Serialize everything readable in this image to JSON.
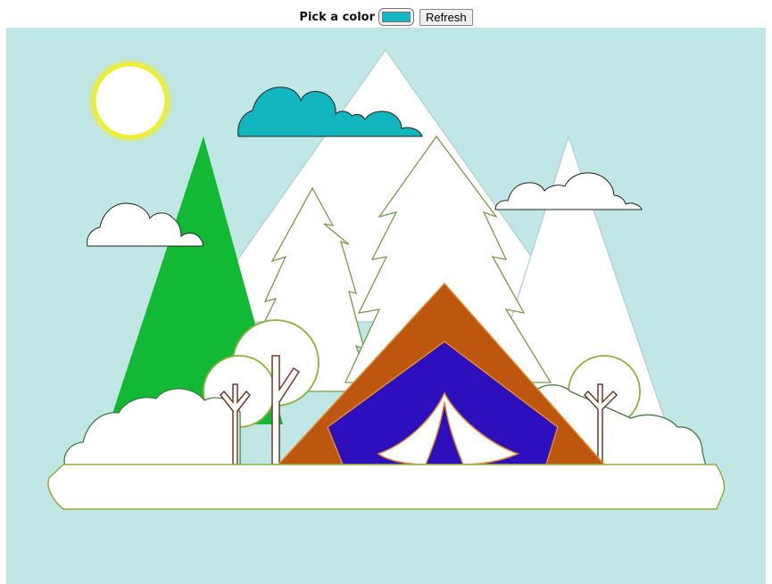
{
  "toolbar": {
    "label": "Pick a color",
    "refresh_label": "Refresh",
    "selected_color": "#12b6be"
  },
  "scene": {
    "sky_color": "#c0e6e5",
    "sun_fill": "#ffffff",
    "sun_glow": "#f2ee25",
    "mountain_fill": "#ffffff",
    "mountain_stroke": "#b7d3d6",
    "left_hill_fill": "#12b935",
    "cloud_main_fill": "#12b6be",
    "cloud_fill": "#ffffff",
    "tree_stroke": "#6e9f45",
    "round_tree_stroke": "#8db13a",
    "trunk_stroke": "#6e3b25",
    "tent_outer_fill": "#bd560f",
    "tent_inner_fill": "#2d0fbd",
    "tent_stroke": "#e08a2c",
    "ground_fill": "#ffffff",
    "ground_stroke": "#8db13a",
    "bush_stroke": "#3f7a3d"
  }
}
